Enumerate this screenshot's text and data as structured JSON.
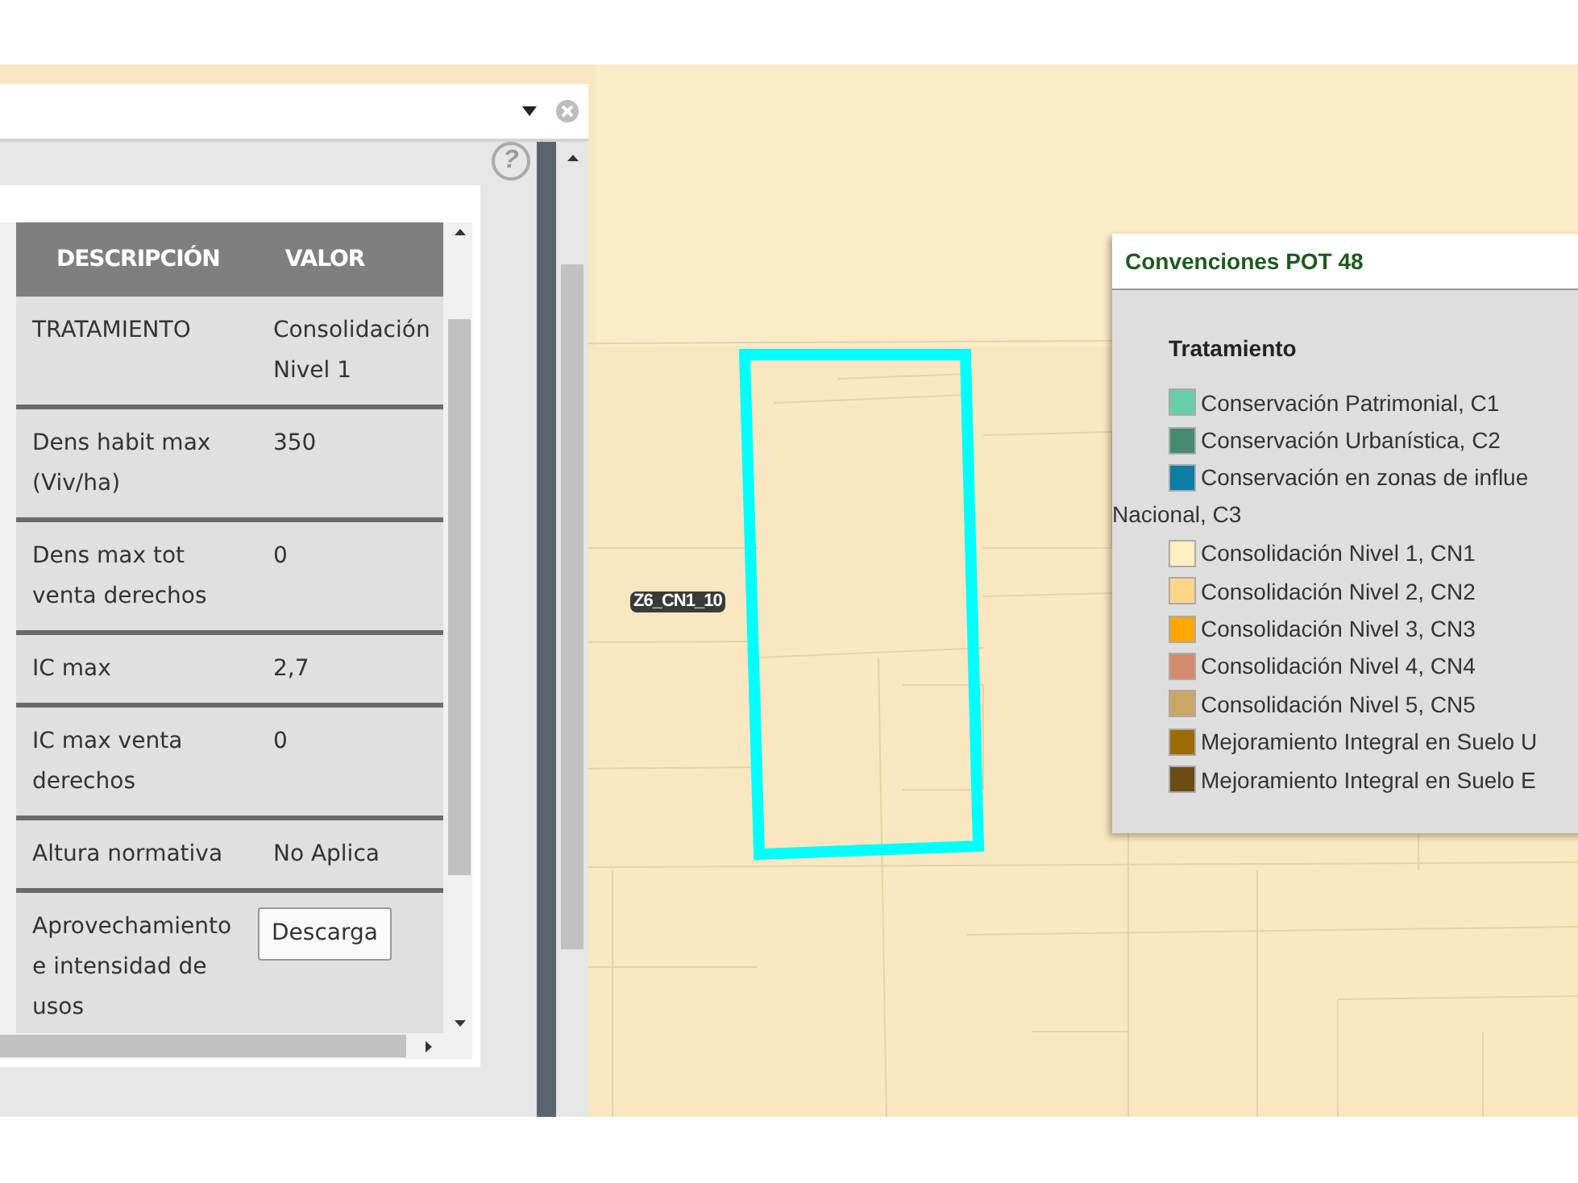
{
  "panel": {
    "help": "?",
    "table": {
      "columns": [
        "DESCRIPCIÓN",
        "VALOR"
      ],
      "rows": [
        {
          "description": "TRATAMIENTO",
          "value": "Consolidación Nivel 1"
        },
        {
          "description": "Dens habit max (Viv/ha)",
          "value": "350"
        },
        {
          "description": "Dens max tot venta derechos",
          "value": "0"
        },
        {
          "description": "IC max",
          "value": "2,7"
        },
        {
          "description": "IC max venta derechos",
          "value": "0"
        },
        {
          "description": "Altura normativa",
          "value": "No Aplica"
        },
        {
          "description": "Aprovechamiento e intensidad de usos",
          "button": "Descarga"
        }
      ]
    }
  },
  "map": {
    "label": "Z6_CN1_10"
  },
  "legend": {
    "title": "Convenciones POT 48",
    "section": "Tratamiento",
    "items": [
      {
        "text": "Conservación Patrimonial, C1",
        "color": "#66cfa8"
      },
      {
        "text": "Conservación Urbanística, C2",
        "color": "#458a6e"
      },
      {
        "text": "Conservación en zonas de influe",
        "continuation": "Nacional, C3",
        "color": "#0b7ea6"
      },
      {
        "text": "Consolidación Nivel 1, CN1",
        "color": "#fff0bf"
      },
      {
        "text": "Consolidación Nivel 2, CN2",
        "color": "#fdd68a"
      },
      {
        "text": "Consolidación Nivel 3, CN3",
        "color": "#ffa600"
      },
      {
        "text": "Consolidación Nivel 4, CN4",
        "color": "#d58a6c"
      },
      {
        "text": "Consolidación Nivel 5, CN5",
        "color": "#caa767"
      },
      {
        "text": "Mejoramiento Integral en Suelo U",
        "color": "#9c6b00"
      },
      {
        "text": "Mejoramiento Integral en Suelo E",
        "color": "#6b4d14"
      }
    ]
  }
}
